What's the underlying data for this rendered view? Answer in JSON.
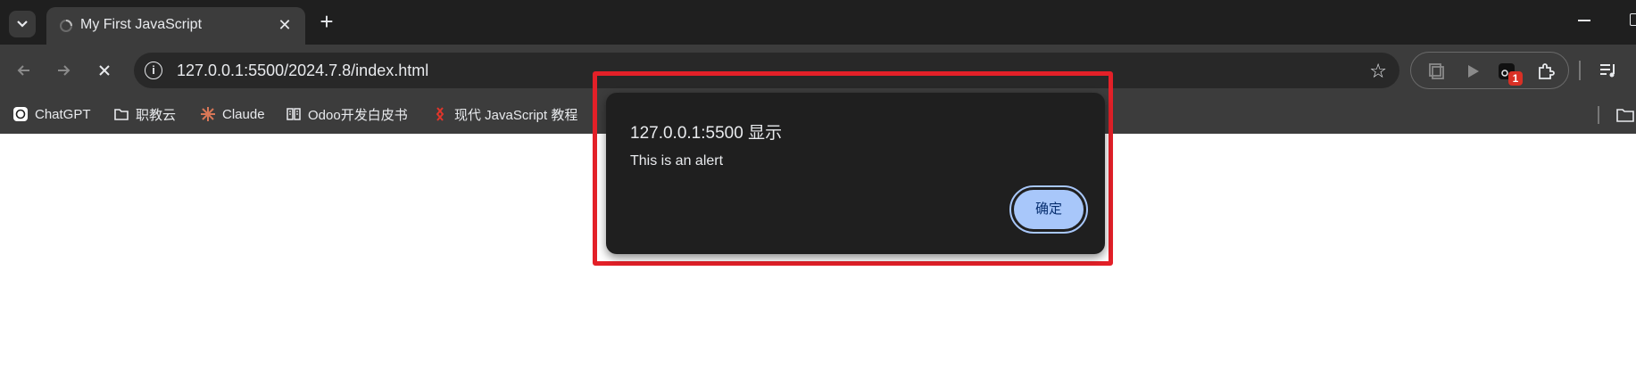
{
  "tab": {
    "title": "My First JavaScript",
    "close_glyph": "✕"
  },
  "new_tab_glyph": "+",
  "toolbar": {
    "url": "127.0.0.1:5500/2024.7.8/index.html",
    "info_glyph": "i",
    "star_glyph": "☆",
    "extension_badge": "1"
  },
  "bookmarks": [
    {
      "label": "ChatGPT",
      "icon": "chatgpt-icon"
    },
    {
      "label": "职教云",
      "icon": "folder-icon"
    },
    {
      "label": "Claude",
      "icon": "claude-icon"
    },
    {
      "label": "Odoo开发白皮书",
      "icon": "book-icon"
    },
    {
      "label": "现代 JavaScript 教程",
      "icon": "js-info-icon"
    }
  ],
  "dialog": {
    "title": "127.0.0.1:5500 显示",
    "message": "This is an alert",
    "ok_label": "确定"
  },
  "colors": {
    "tabstrip_bg": "#1f1f1f",
    "toolbar_bg": "#3c3c3c",
    "omnibox_bg": "#282828",
    "dialog_bg": "#1f1f1f",
    "ok_button": "#a8c7fa",
    "highlight": "#e32028",
    "badge": "#d93025"
  }
}
